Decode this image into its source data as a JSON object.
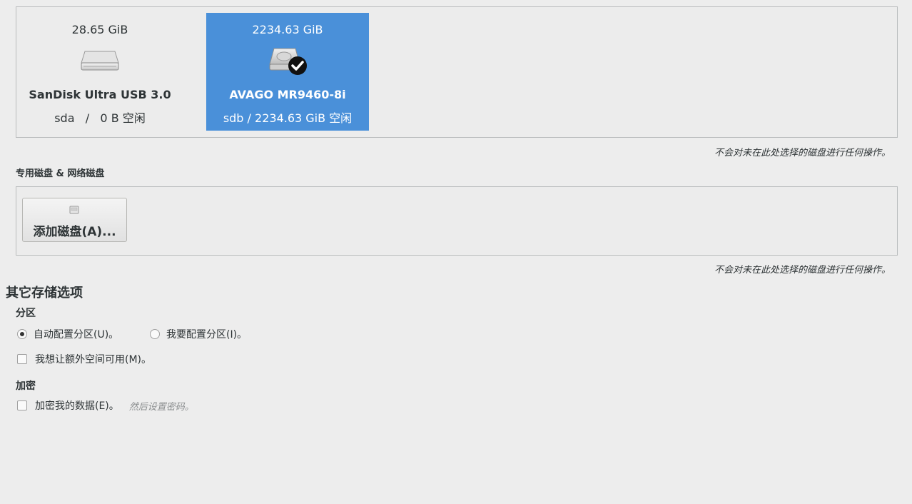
{
  "local_disks": [
    {
      "size": "28.65 GiB",
      "name": "SanDisk Ultra USB 3.0",
      "free": "sda   /   0 B 空闲",
      "icon": "usb-drive-icon",
      "selected": false
    },
    {
      "size": "2234.63 GiB",
      "name": "AVAGO MR9460-8i",
      "free": "sdb / 2234.63 GiB 空闲",
      "icon": "hard-disk-icon",
      "selected": true
    }
  ],
  "notes": {
    "local": "不会对未在此处选择的磁盘进行任何操作。",
    "special": "不会对未在此处选择的磁盘进行任何操作。"
  },
  "special_section": {
    "heading": "专用磁盘 & 网络磁盘",
    "add_button_label": "添加磁盘(A)...",
    "add_button_icon": "add-disk-icon"
  },
  "other_options": {
    "heading": "其它存储选项",
    "partitioning": {
      "heading": "分区",
      "auto_label": "自动配置分区(U)。",
      "manual_label": "我要配置分区(I)。",
      "selected": "auto",
      "extra_space_label": "我想让额外空间可用(M)。"
    },
    "encryption": {
      "heading": "加密",
      "encrypt_label": "加密我的数据(E)。",
      "hint": "然后设置密码。"
    }
  },
  "colors": {
    "selection": "#4a90d9",
    "background": "#ededed"
  }
}
